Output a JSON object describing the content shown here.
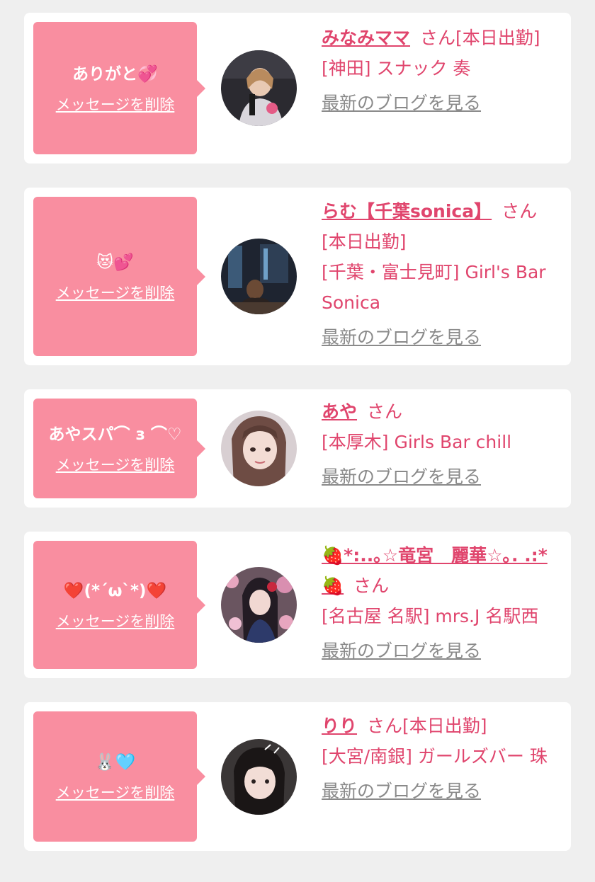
{
  "cards": [
    {
      "message": "ありがと💞",
      "delete_label": "メッセージを削除",
      "name": "みなみママ",
      "honorific": "さん",
      "status": "[本日出勤]",
      "shop": "[神田] スナック 奏",
      "blog_label": "最新のブログを見る"
    },
    {
      "message": "😻💕",
      "delete_label": "メッセージを削除",
      "name": "らむ【千葉sonica】",
      "honorific": "さん",
      "status": "[本日出勤]",
      "shop": "[千葉・富士見町] Girl's Bar Sonica",
      "blog_label": "最新のブログを見る"
    },
    {
      "message": "あやスパ⌒ з ⌒♡",
      "delete_label": "メッセージを削除",
      "name": "あや",
      "honorific": "さん",
      "status": "",
      "shop": "[本厚木] Girls Bar chill",
      "blog_label": "最新のブログを見る"
    },
    {
      "message": "❤️(*´ω`*)❤️",
      "delete_label": "メッセージを削除",
      "name": "🍓*:..｡☆竜宮　麗華☆｡. .:*🍓",
      "honorific": "さん",
      "status": "",
      "shop": "[名古屋 名駅] mrs.J 名駅西",
      "blog_label": "最新のブログを見る"
    },
    {
      "message": "🐰🩵",
      "delete_label": "メッセージを削除",
      "name": "りり",
      "honorific": "さん",
      "status": "[本日出勤]",
      "shop": "[大宮/南銀] ガールズバー 珠",
      "blog_label": "最新のブログを見る"
    }
  ],
  "colors": {
    "accent": "#e0456d",
    "bubble": "#f98ea0",
    "background": "#efefef",
    "link_gray": "#8a8a8a"
  }
}
